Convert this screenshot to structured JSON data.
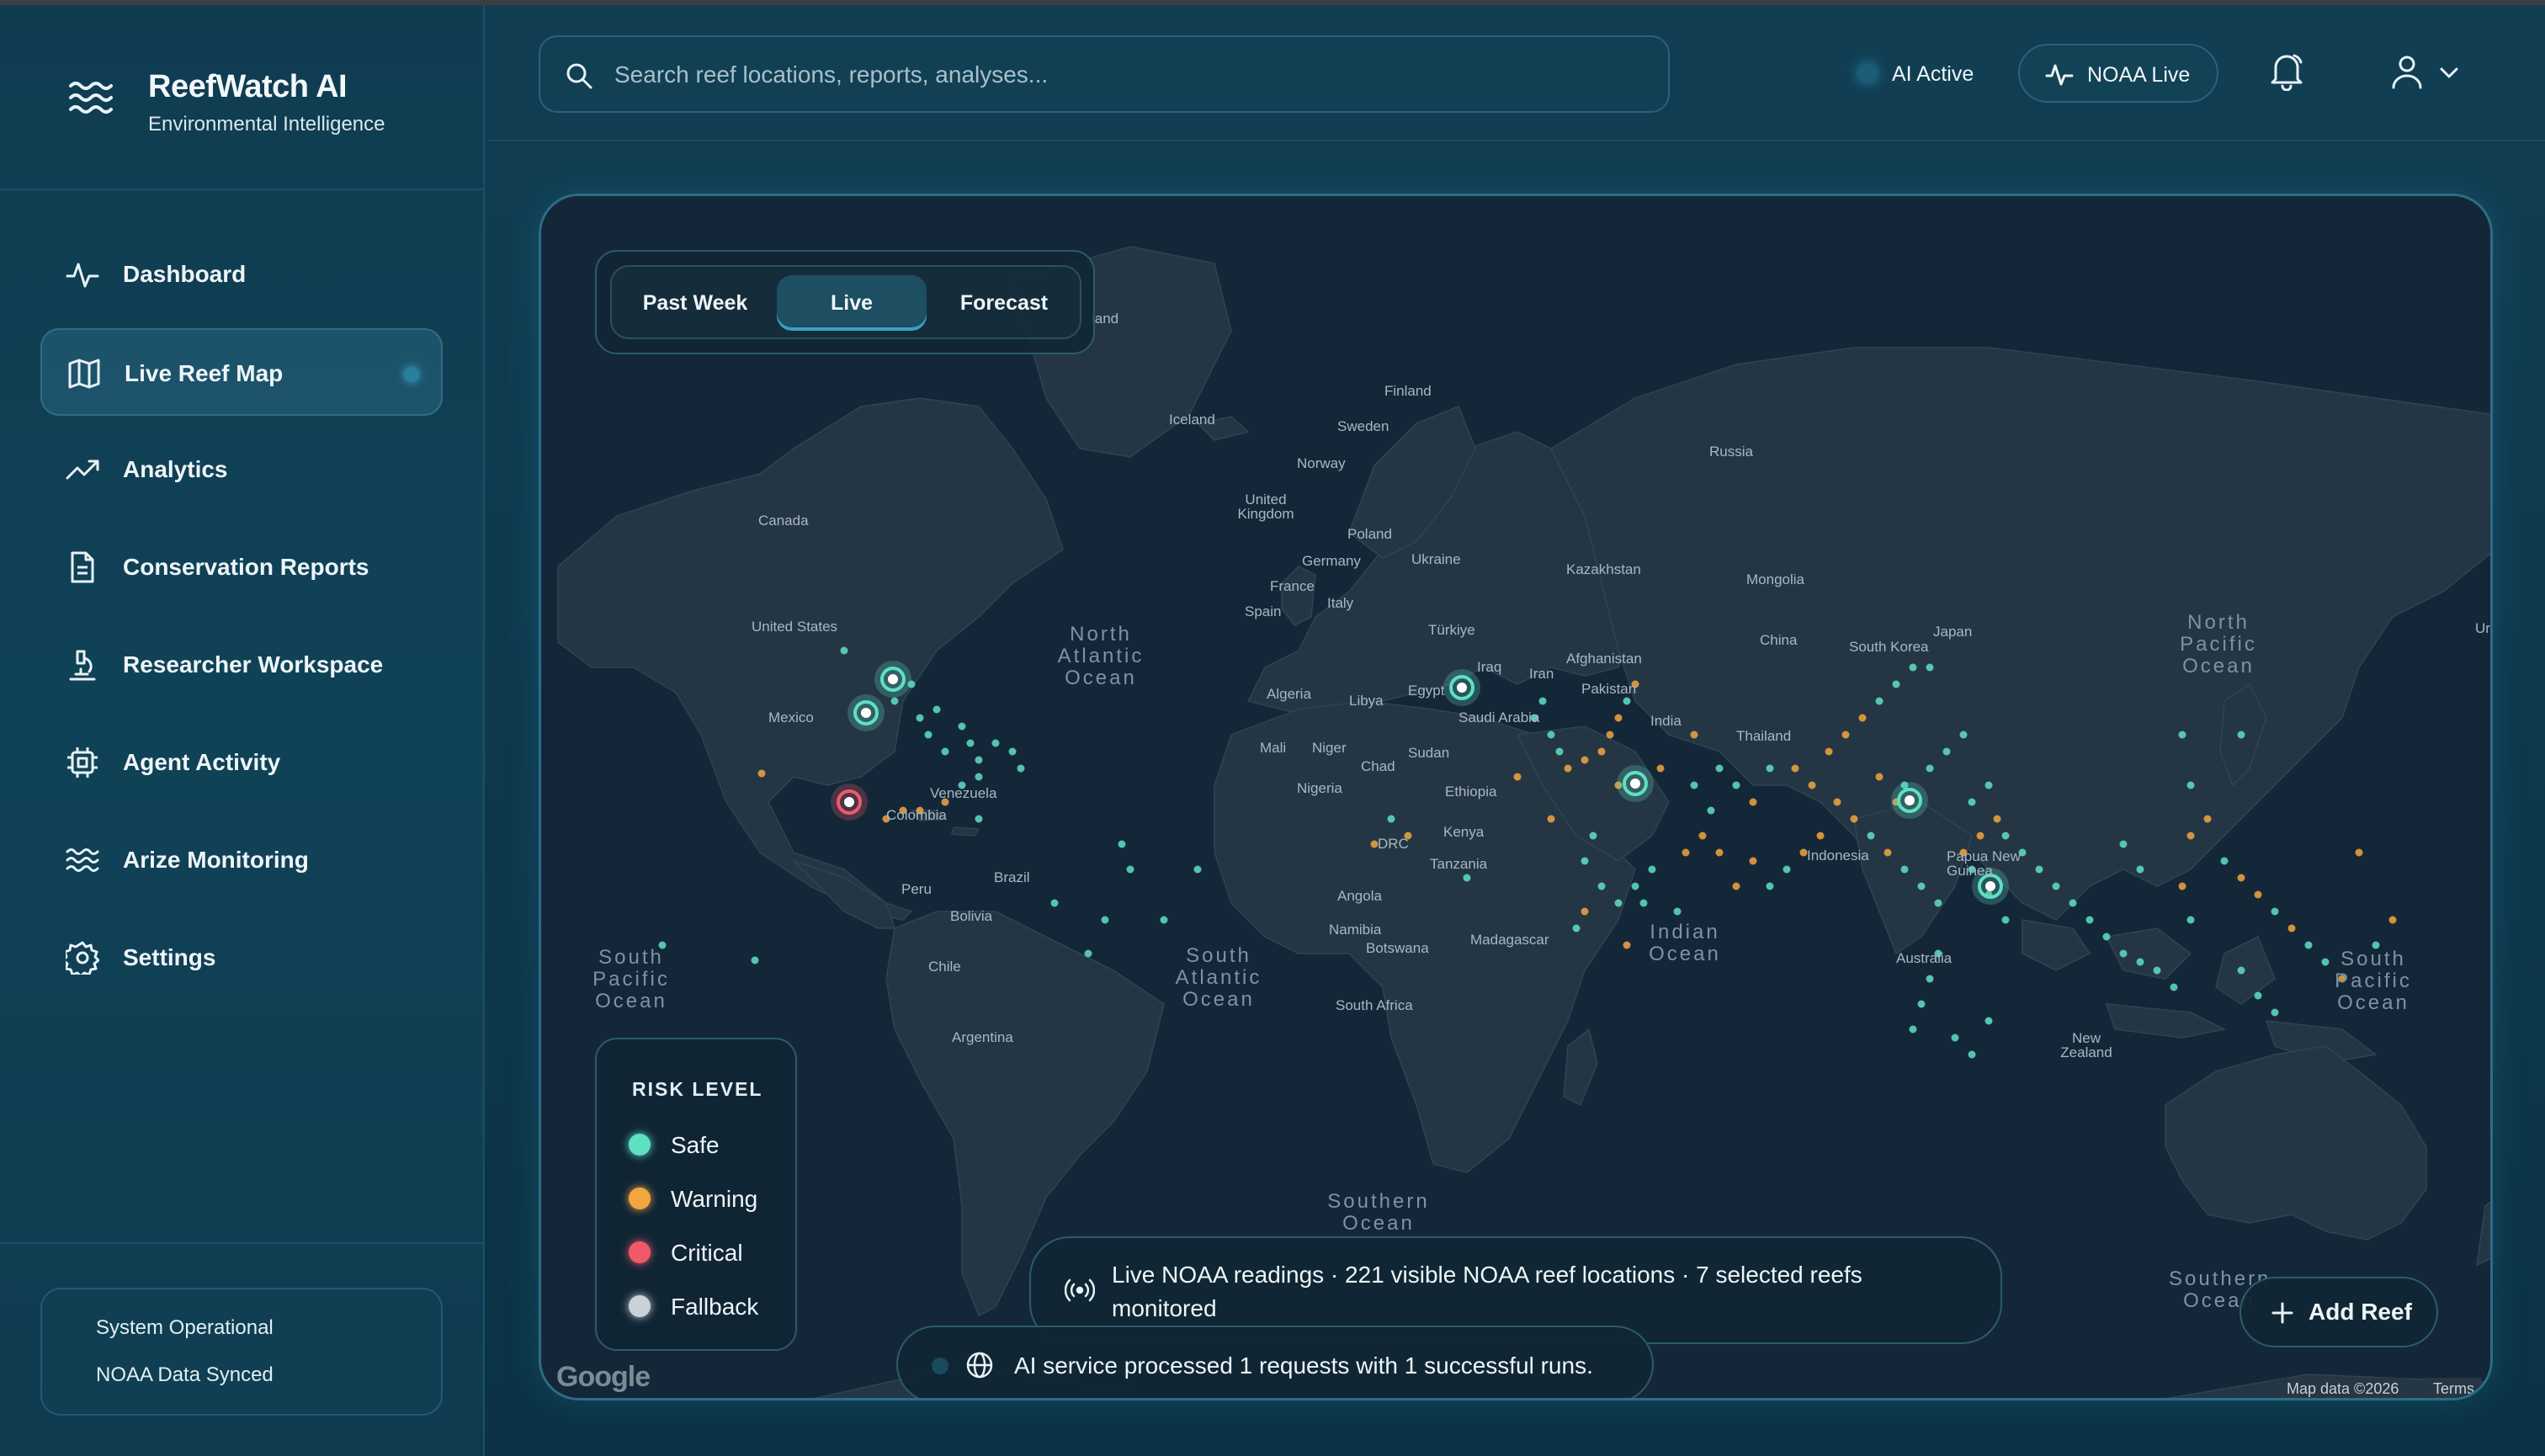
{
  "brand": {
    "title": "ReefWatch AI",
    "subtitle": "Environmental Intelligence",
    "icon": "waves-icon"
  },
  "sidebar": {
    "items": [
      {
        "label": "Dashboard",
        "icon": "activity-icon",
        "active": false
      },
      {
        "label": "Live Reef Map",
        "icon": "map-icon",
        "active": true
      },
      {
        "label": "Analytics",
        "icon": "trending-up-icon",
        "active": false
      },
      {
        "label": "Conservation Reports",
        "icon": "document-icon",
        "active": false
      },
      {
        "label": "Researcher Workspace",
        "icon": "microscope-icon",
        "active": false
      },
      {
        "label": "Agent Activity",
        "icon": "cpu-icon",
        "active": false
      },
      {
        "label": "Arize Monitoring",
        "icon": "waves-icon",
        "active": false
      },
      {
        "label": "Settings",
        "icon": "gear-icon",
        "active": false
      }
    ],
    "status": {
      "line1": "System Operational",
      "line2": "NOAA Data Synced"
    }
  },
  "header": {
    "search_placeholder": "Search reef locations, reports, analyses...",
    "ai_status": "AI Active",
    "noaa_status": "NOAA Live"
  },
  "map": {
    "time_tabs": [
      "Past Week",
      "Live",
      "Forecast"
    ],
    "active_tab": "Live",
    "legend": {
      "title": "RISK LEVEL",
      "items": [
        {
          "label": "Safe",
          "color": "#5ee0c2"
        },
        {
          "label": "Warning",
          "color": "#f2a640"
        },
        {
          "label": "Critical",
          "color": "#ef5a6a"
        },
        {
          "label": "Fallback",
          "color": "#c9d2d8"
        }
      ]
    },
    "countries": [
      "Finland",
      "Sweden",
      "Iceland",
      "Norway",
      "Russia",
      "Canada",
      "United Kingdom",
      "Poland",
      "Germany",
      "Ukraine",
      "Kazakhstan",
      "Mongolia",
      "France",
      "Italy",
      "Spain",
      "Türkiye",
      "Afghanistan",
      "China",
      "South Korea",
      "Japan",
      "United States",
      "Iraq",
      "Iran",
      "Pakistan",
      "Algeria",
      "Libya",
      "Egypt",
      "Saudi Arabia",
      "India",
      "Mexico",
      "Thailand",
      "Mali",
      "Niger",
      "Chad",
      "Sudan",
      "Nigeria",
      "Ethiopia",
      "Venezuela",
      "Colombia",
      "Kenya",
      "DRC",
      "Indonesia",
      "Papua New Guinea",
      "Tanzania",
      "Peru",
      "Brazil",
      "Bolivia",
      "Angola",
      "Namibia",
      "Botswana",
      "Madagascar",
      "Chile",
      "Australia",
      "South Africa",
      "Argentina",
      "New Zealand",
      "land",
      "Ur"
    ],
    "oceans": [
      "North Atlantic Ocean",
      "North Pacific Ocean",
      "South Pacific Ocean",
      "South Atlantic Ocean",
      "Indian Ocean",
      "South Pacific Ocean",
      "Southern Ocean",
      "Southern Ocean"
    ],
    "live_text": "Live NOAA readings · 221 visible NOAA reef locations · 7 selected reefs monitored",
    "ai_text": "AI service processed 1 requests with 1 successful runs.",
    "add_reef": "Add Reef",
    "google": "Google",
    "attribution": "Map data ©2026",
    "terms": "Terms"
  },
  "colors": {
    "safe": "#5ee0c2",
    "warning": "#f2a640",
    "critical": "#ef5a6a",
    "accent": "#3b9fc4"
  }
}
